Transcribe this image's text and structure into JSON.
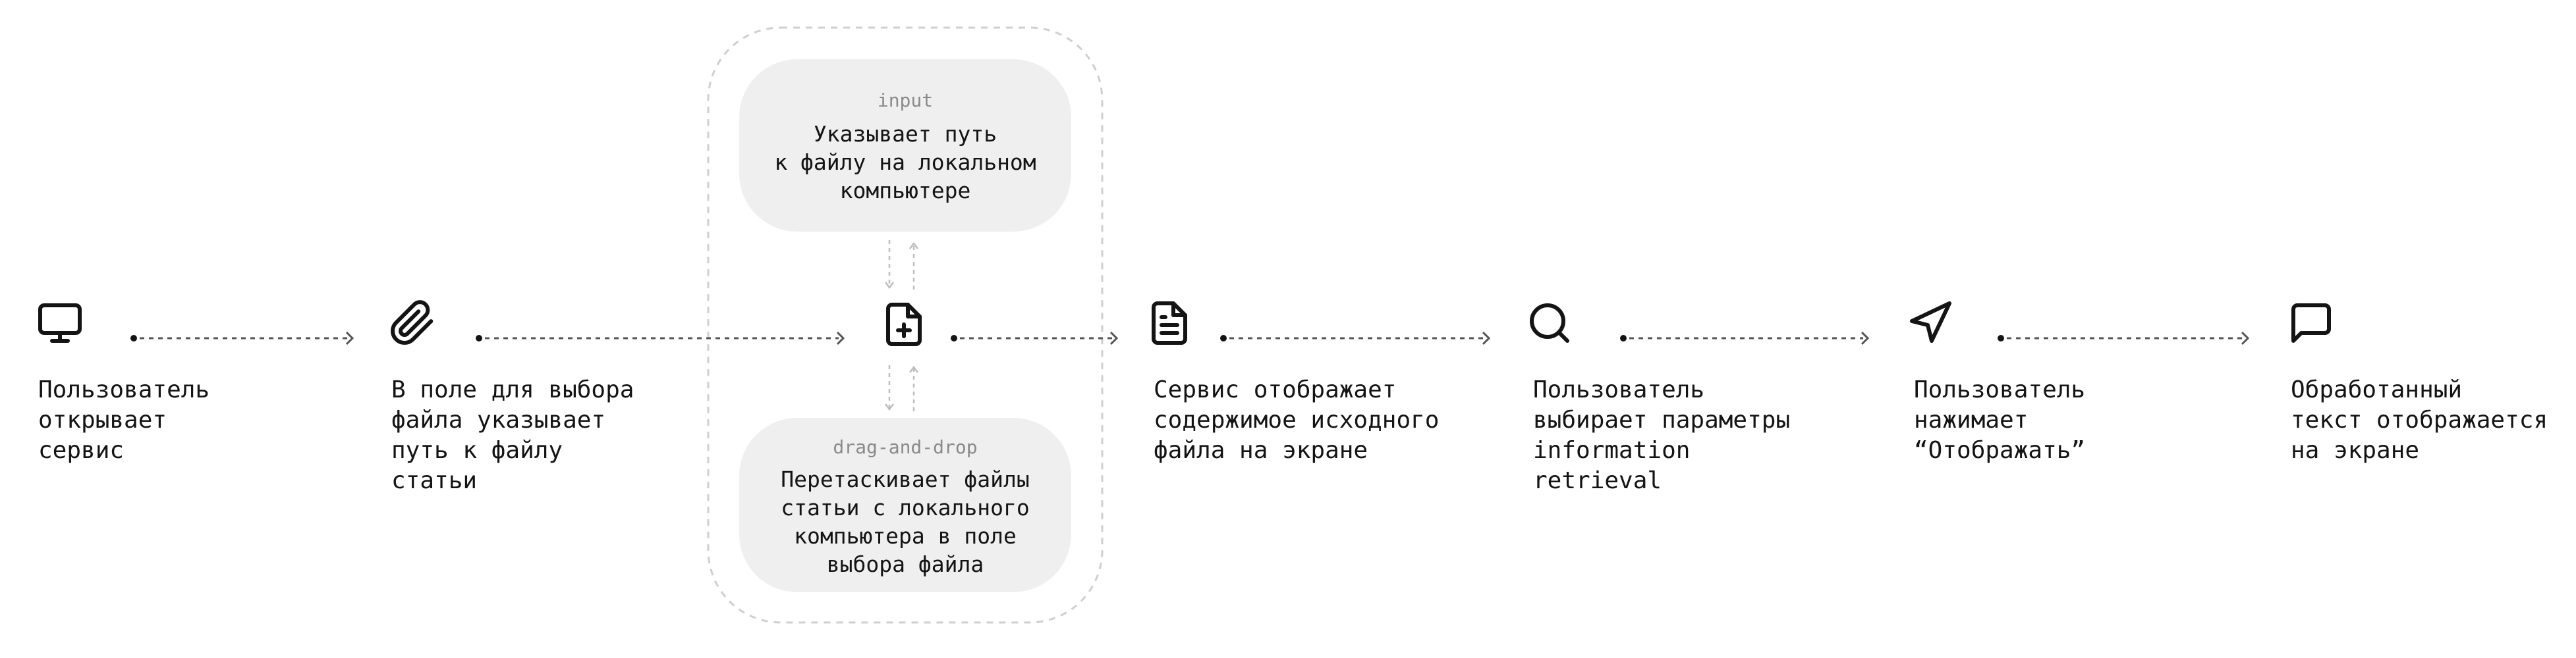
{
  "steps": [
    {
      "icon": "monitor-icon",
      "text": "Пользователь\nоткрывает\nсервис"
    },
    {
      "icon": "paperclip-icon",
      "text": "В поле для выбора\nфайла указывает\nпуть к файлу\nстатьи"
    },
    {
      "icon": "file-plus-icon",
      "text": ""
    },
    {
      "icon": "file-text-icon",
      "text": "Сервис отображает\nсодержимое исходного\nфайла на экране"
    },
    {
      "icon": "search-icon",
      "text": "Пользователь\nвыбирает параметры\ninformation\nretrieval"
    },
    {
      "icon": "send-icon",
      "text": "Пользователь\nнажимает\n“Отображать”"
    },
    {
      "icon": "message-square-icon",
      "text": "Обработанный\nтекст отображается\nна экране"
    }
  ],
  "options": {
    "input": {
      "label": "input",
      "text": "Указывает путь\nк файлу на локальном\nкомпьютере"
    },
    "drag_and_drop": {
      "label": "drag-and-drop",
      "text": "Перетаскивает файлы\nстатьи с локального\nкомпьютера в поле\nвыбора файла"
    }
  },
  "colors": {
    "ink": "#141414",
    "muted": "#8a8a8a",
    "card": "#efefef",
    "dashed_group": "#cfcfcf",
    "connector": "#555555"
  }
}
